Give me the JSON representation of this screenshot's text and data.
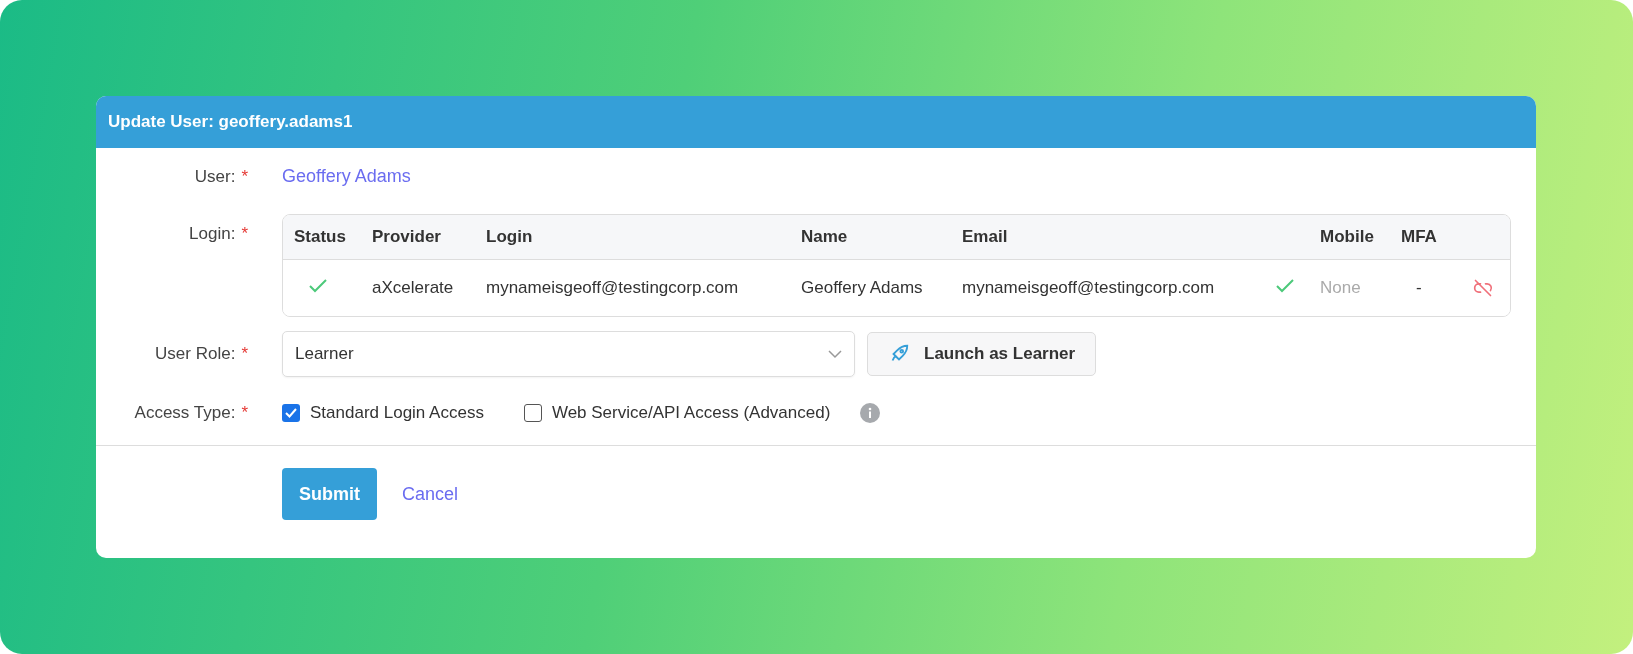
{
  "dialog": {
    "title": "Update User: geoffery.adams1"
  },
  "fields": {
    "user": {
      "label": "User:",
      "required_mark": "*",
      "value": "Geoffery Adams"
    },
    "login": {
      "label": "Login:",
      "required_mark": "*"
    },
    "user_role": {
      "label": "User Role:",
      "required_mark": "*",
      "value": "Learner",
      "launch_button": "Launch as Learner"
    },
    "access_type": {
      "label": "Access Type:",
      "required_mark": "*",
      "options": [
        {
          "label": "Standard Login Access",
          "checked": true
        },
        {
          "label": "Web Service/API Access (Advanced)",
          "checked": false
        }
      ]
    }
  },
  "login_table": {
    "columns": [
      "Status",
      "Provider",
      "Login",
      "Name",
      "Email",
      "Mobile",
      "MFA"
    ],
    "rows": [
      {
        "status_ok": true,
        "provider": "aXcelerate",
        "login": "mynameisgeoff@testingcorp.com",
        "name": "Geoffery Adams",
        "email": "mynameisgeoff@testingcorp.com",
        "email_verified": true,
        "mobile": "None",
        "mfa": "-"
      }
    ]
  },
  "actions": {
    "submit": "Submit",
    "cancel": "Cancel"
  }
}
